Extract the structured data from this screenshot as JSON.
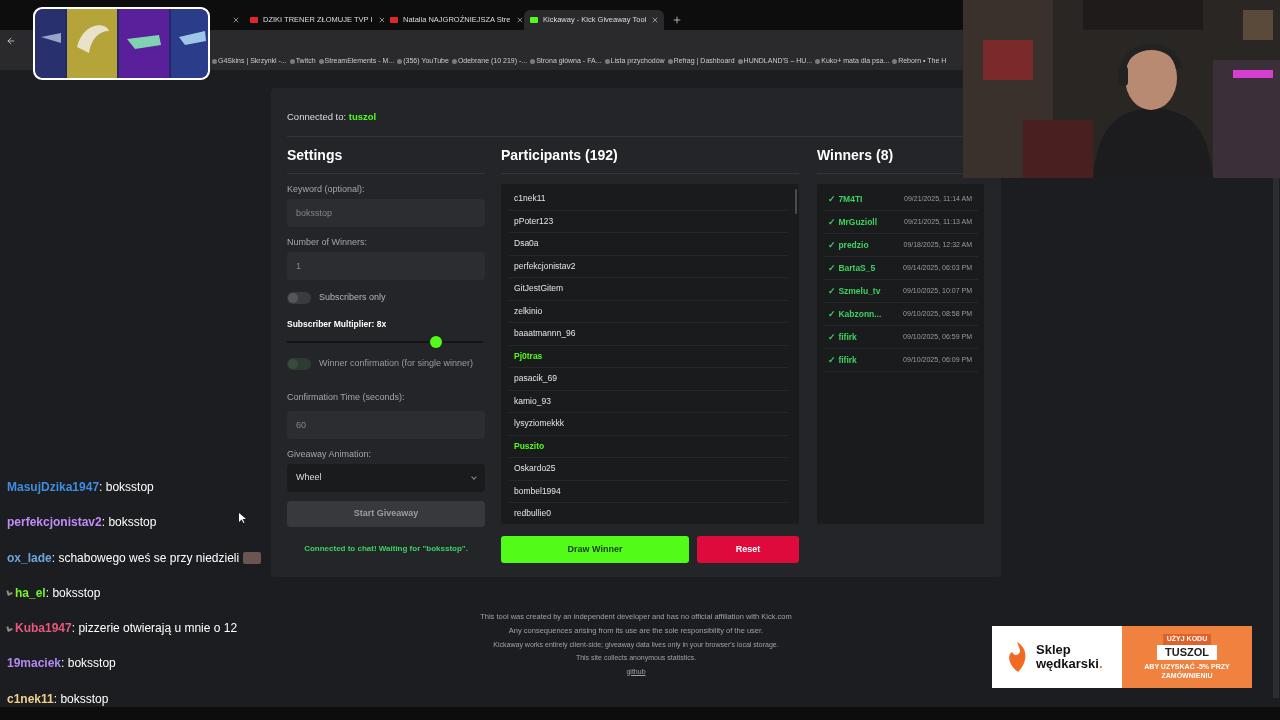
{
  "browser": {
    "tabs": [
      {
        "title": "DZIKI TRENER ZŁOMUJE TVP I",
        "selected": false
      },
      {
        "title": "Natalia NAJGROŹNIEJSZA Stre",
        "selected": false
      },
      {
        "title": "Kickaway - Kick Giveaway Tool",
        "selected": true
      }
    ],
    "bookmarks": [
      "G4Skins | Skrzynki -...",
      "Twitch",
      "StreamElements - M...",
      "(356) YouTube",
      "Odebrane (10 219) -...",
      "Strona główna - FA...",
      "Lista przychodów",
      "Refrag | Dashboard",
      "HUNDLAND'S – HU...",
      "Kuko+ mata dla psa...",
      "Reborn • The H"
    ]
  },
  "app": {
    "connected_label": "Connected to:",
    "connected_channel": "tuszol",
    "settings": {
      "title": "Settings",
      "keyword_label": "Keyword (optional):",
      "keyword_placeholder": "boksstop",
      "winners_label": "Number of Winners:",
      "winners_placeholder": "1",
      "subscribers_only": {
        "label": "Subscribers only",
        "on": false,
        "disabled": false
      },
      "multiplier": {
        "label": "Subscriber Multiplier:",
        "value": "8x",
        "level": 0.76
      },
      "winner_confirmation": {
        "label": "Winner confirmation (for single winner)",
        "on": false,
        "disabled": true
      },
      "time_label": "Confirmation Time (seconds):",
      "time_placeholder": "60",
      "animation_label": "Giveaway Animation:",
      "animation_value": "Wheel",
      "start_button": "Start Giveaway",
      "status": "Connected to chat! Waiting for \"boksstop\"."
    },
    "participants": {
      "title": "Participants (192)",
      "items": [
        {
          "name": "c1nek11",
          "highlighted": false
        },
        {
          "name": "pPoter123",
          "highlighted": false
        },
        {
          "name": "Dsa0a",
          "highlighted": false
        },
        {
          "name": "perfekcjonistav2",
          "highlighted": false
        },
        {
          "name": "GitJestGitem",
          "highlighted": false
        },
        {
          "name": "zelkinio",
          "highlighted": false
        },
        {
          "name": "baaatmannn_96",
          "highlighted": false
        },
        {
          "name": "Pj0tras",
          "highlighted": true
        },
        {
          "name": "pasacik_69",
          "highlighted": false
        },
        {
          "name": "kamio_93",
          "highlighted": false
        },
        {
          "name": "lysyziomekkk",
          "highlighted": false
        },
        {
          "name": "Puszito",
          "highlighted": true
        },
        {
          "name": "Oskardo25",
          "highlighted": false
        },
        {
          "name": "bombel1994",
          "highlighted": false
        },
        {
          "name": "redbullie0",
          "highlighted": false
        }
      ],
      "draw_button": "Draw Winner",
      "reset_button": "Reset"
    },
    "winners": {
      "title": "Winners (8)",
      "items": [
        {
          "mark": "✓",
          "name": "7M4TI",
          "time": "09/21/2025, 11:14 AM"
        },
        {
          "mark": "✓",
          "name": "MrGuzioll",
          "time": "09/21/2025, 11:13 AM"
        },
        {
          "mark": "✓",
          "name": "predzio",
          "time": "09/18/2025, 12:32 AM"
        },
        {
          "mark": "✓",
          "name": "BartaS_5",
          "time": "09/14/2025, 06:03 PM"
        },
        {
          "mark": "✓",
          "name": "Szmelu_tv",
          "time": "09/10/2025, 10:07 PM"
        },
        {
          "mark": "✓",
          "name": "Kabzonn...",
          "time": "09/10/2025, 08:58 PM"
        },
        {
          "mark": "✓",
          "name": "fifirk",
          "time": "09/10/2025, 06:59 PM"
        },
        {
          "mark": "✓",
          "name": "fifirk",
          "time": "09/10/2025, 06:09 PM"
        }
      ]
    },
    "footer": {
      "lines": [
        "This tool was created by an independent developer and has no official affiliation with Kick.com",
        "Any consequences arising from its use are the sole responsibility of the user.",
        "Kickaway works entirely client-side; giveaway data lives only in your browser's local storage.",
        "This site collects anonymous statistics."
      ],
      "link": "github"
    }
  },
  "chat": [
    {
      "user": "MasujDzika1947",
      "separator": ":",
      "color": "#3f8de0",
      "badge": false,
      "emote": false,
      "message": "boksstop"
    },
    {
      "user": "perfekcjonistav2",
      "separator": ":",
      "color": "#c08cf5",
      "badge": false,
      "emote": false,
      "message": "boksstop"
    },
    {
      "user": "ox_lade",
      "separator": ":",
      "color": "#6aa6de",
      "badge": false,
      "emote": true,
      "message": "schabowego weś se przy niedzieli"
    },
    {
      "user": "ha_el",
      "separator": ":",
      "color": "#7df02a",
      "badge": true,
      "emote": false,
      "message": "boksstop"
    },
    {
      "user": "Kuba1947",
      "separator": ":",
      "color": "#e8577e",
      "badge": true,
      "emote": false,
      "message": "pizzerie otwierają u mnie o 12"
    },
    {
      "user": "19maciek",
      "separator": ":",
      "color": "#b08af0",
      "badge": false,
      "emote": false,
      "message": "boksstop"
    },
    {
      "user": "c1nek11",
      "separator": ":",
      "color": "#f0cf8a",
      "badge": false,
      "emote": false,
      "message": "boksstop"
    }
  ],
  "ad": {
    "brand_line1": "Sklep",
    "brand_line2": "wędkarski",
    "brand_dot": ".",
    "code_label": "UŻYJ KODU",
    "code": "TUSZOL",
    "offer_line1": "ABY UZYSKAĆ -5% PRZY",
    "offer_line2": "ZAMÓWNIENIU"
  }
}
